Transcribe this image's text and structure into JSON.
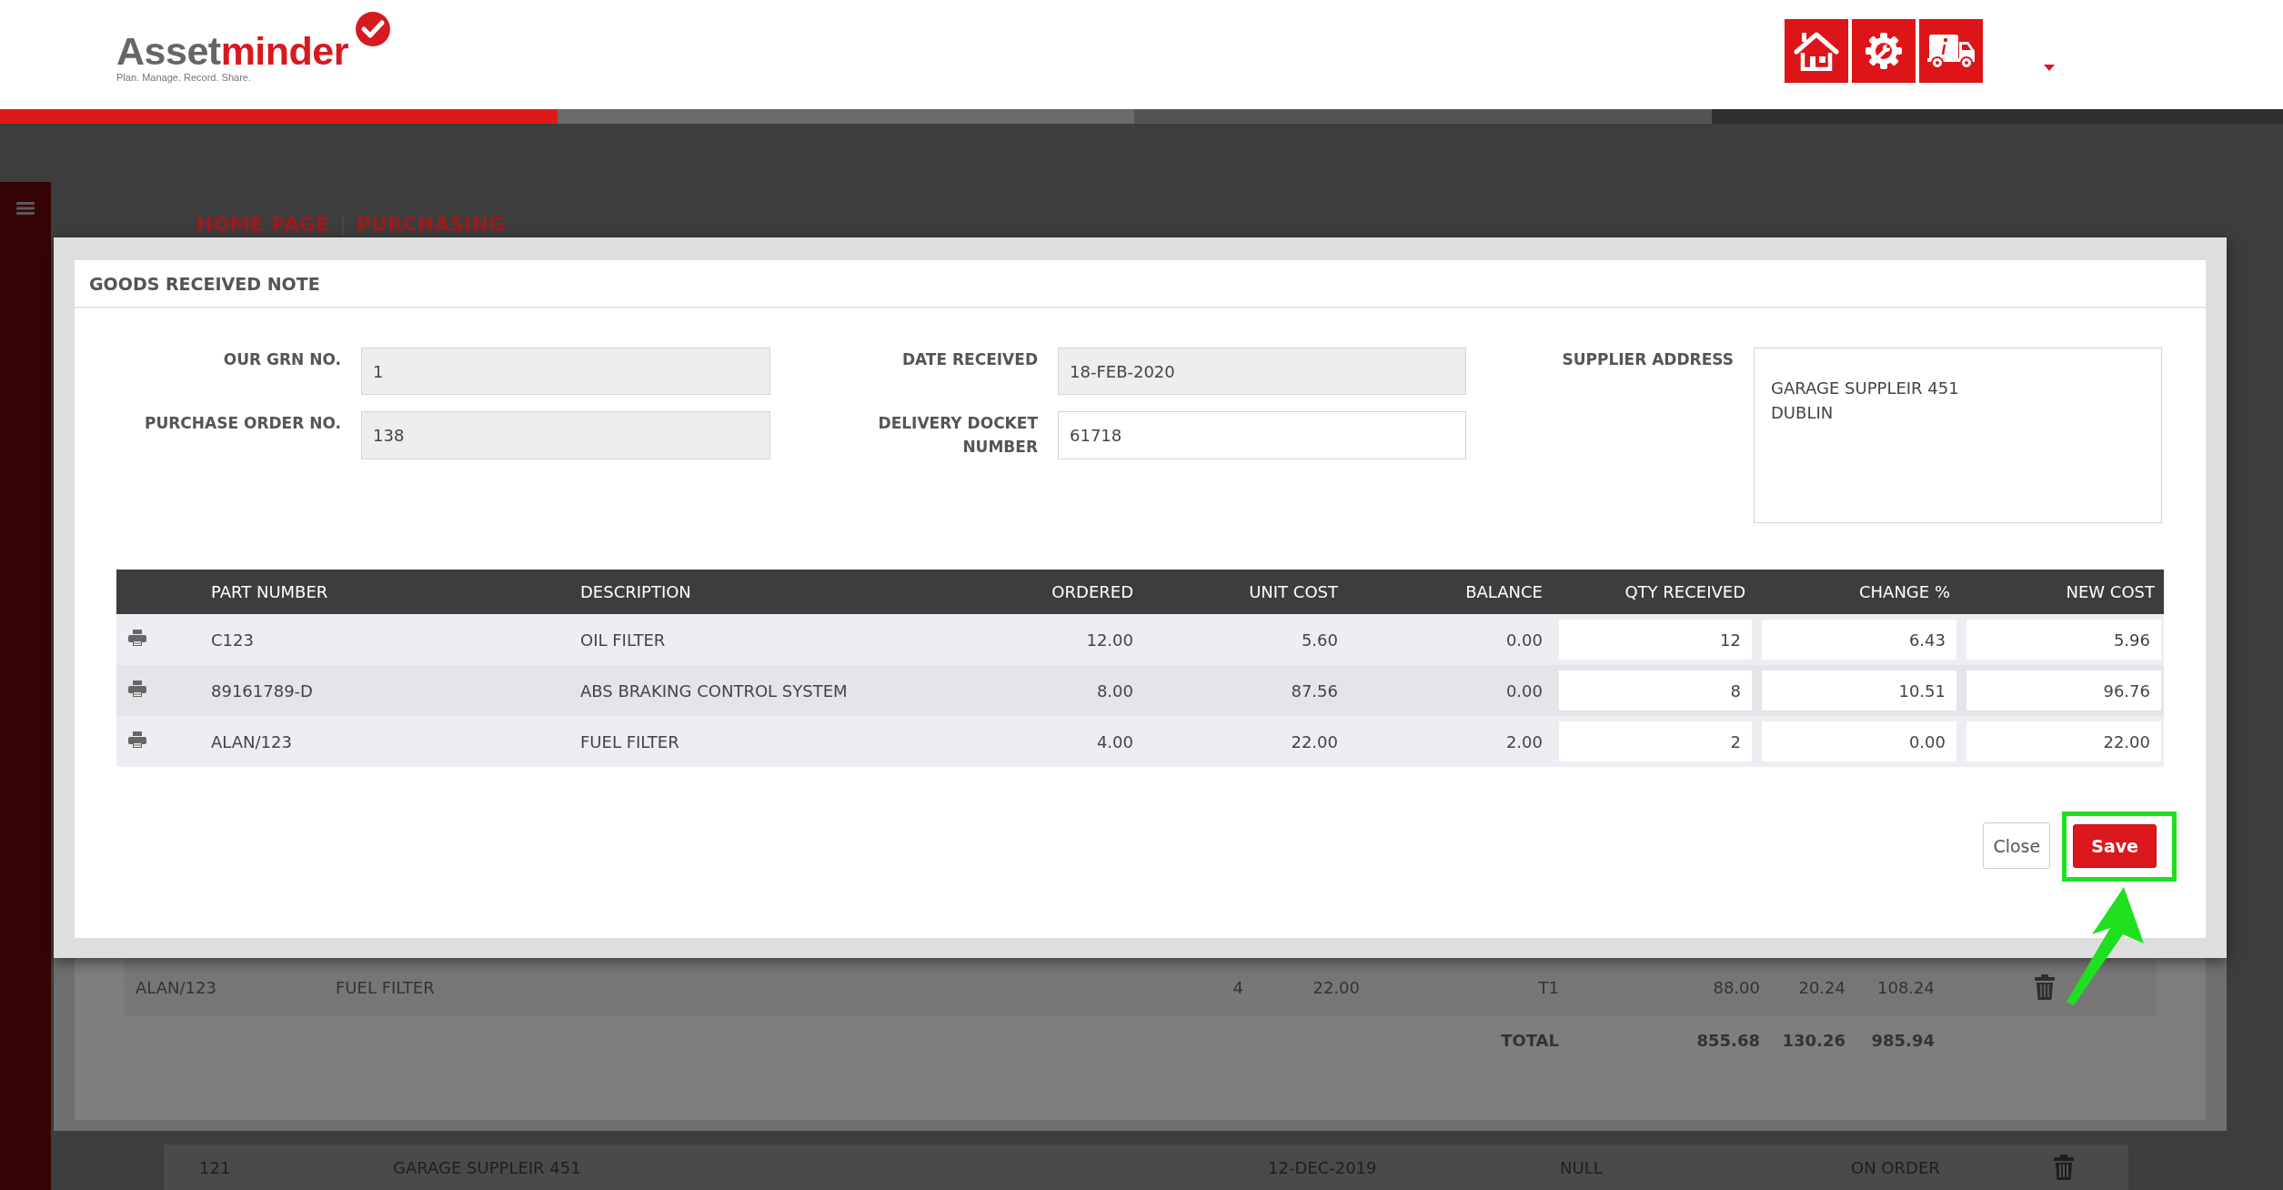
{
  "header": {
    "logo": {
      "primary": "Asset",
      "accent": "minder",
      "tagline": "Plan. Manage. Record. Share."
    }
  },
  "breadcrumb": [
    {
      "label": "HOME PAGE"
    },
    {
      "label": "PURCHASING"
    }
  ],
  "background": {
    "line_rows": [
      {
        "cells": [
          "ALAN/123",
          "FUEL FILTER",
          "4",
          "22.00",
          "T1",
          "88.00",
          "20.24",
          "108.24"
        ]
      }
    ],
    "totals": {
      "label": "TOTAL",
      "values": [
        "855.68",
        "130.26",
        "985.94"
      ]
    },
    "order_rows": [
      {
        "cells": [
          "121",
          "GARAGE SUPPLEIR 451",
          "12-DEC-2019",
          "NULL",
          "ON ORDER"
        ]
      }
    ]
  },
  "modal": {
    "title": "GOODS RECEIVED NOTE",
    "fields": [
      {
        "label": "OUR GRN NO.",
        "value": "1",
        "readonly": true
      },
      {
        "label": "DATE RECEIVED",
        "value": "18-FEB-2020",
        "readonly": true
      },
      {
        "label": "PURCHASE ORDER NO.",
        "value": "138",
        "readonly": true
      },
      {
        "label": "DELIVERY DOCKET NUMBER",
        "value": "61718",
        "readonly": false
      }
    ],
    "supplier_address": {
      "label": "SUPPLIER ADDRESS",
      "lines": [
        "GARAGE SUPPLEIR 451",
        "DUBLIN"
      ]
    },
    "table": {
      "columns": [
        "PART NUMBER",
        "DESCRIPTION",
        "ORDERED",
        "UNIT COST",
        "BALANCE",
        "QTY RECEIVED",
        "CHANGE %",
        "NEW COST"
      ],
      "rows": [
        {
          "part_number": "C123",
          "description": "OIL FILTER",
          "ordered": "12.00",
          "unit_cost": "5.60",
          "balance": "0.00",
          "qty_received": "12",
          "change_pct": "6.43",
          "new_cost": "5.96"
        },
        {
          "part_number": "89161789-D",
          "description": "ABS BRAKING CONTROL SYSTEM",
          "ordered": "8.00",
          "unit_cost": "87.56",
          "balance": "0.00",
          "qty_received": "8",
          "change_pct": "10.51",
          "new_cost": "96.76"
        },
        {
          "part_number": "ALAN/123",
          "description": "FUEL FILTER",
          "ordered": "4.00",
          "unit_cost": "22.00",
          "balance": "2.00",
          "qty_received": "2",
          "change_pct": "0.00",
          "new_cost": "22.00"
        }
      ]
    },
    "buttons": [
      {
        "label": "Close",
        "kind": "secondary"
      },
      {
        "label": "Save",
        "kind": "primary"
      }
    ]
  }
}
